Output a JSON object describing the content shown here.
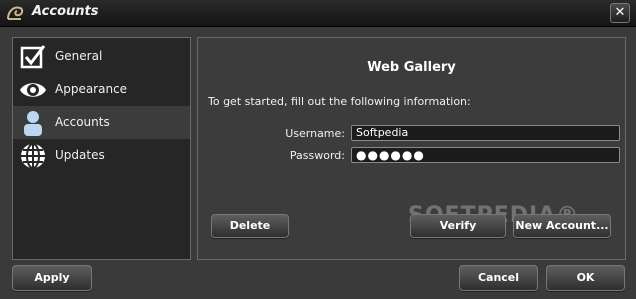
{
  "window": {
    "title": "Accounts",
    "close_glyph": "✕"
  },
  "sidebar": {
    "items": [
      {
        "label": "General",
        "icon": "checkbox-icon",
        "selected": false
      },
      {
        "label": "Appearance",
        "icon": "eye-icon",
        "selected": false
      },
      {
        "label": "Accounts",
        "icon": "person-icon",
        "selected": true
      },
      {
        "label": "Updates",
        "icon": "globe-icon",
        "selected": false
      }
    ]
  },
  "panel": {
    "title": "Web Gallery",
    "instructions": "To get started, fill out the following information:",
    "username_label": "Username:",
    "username_value": "Softpedia",
    "password_label": "Password:",
    "password_mask": "●●●●●●",
    "delete_label": "Delete",
    "verify_label": "Verify",
    "new_account_label": "New Account..."
  },
  "footer": {
    "apply_label": "Apply",
    "cancel_label": "Cancel",
    "ok_label": "OK"
  },
  "watermark": "SOFTPEDIA®",
  "colors": {
    "background": "#3a3a3a",
    "titlebar": "#1a1a1a",
    "sidebar": "#262626",
    "selected": "#3c3c3c"
  }
}
